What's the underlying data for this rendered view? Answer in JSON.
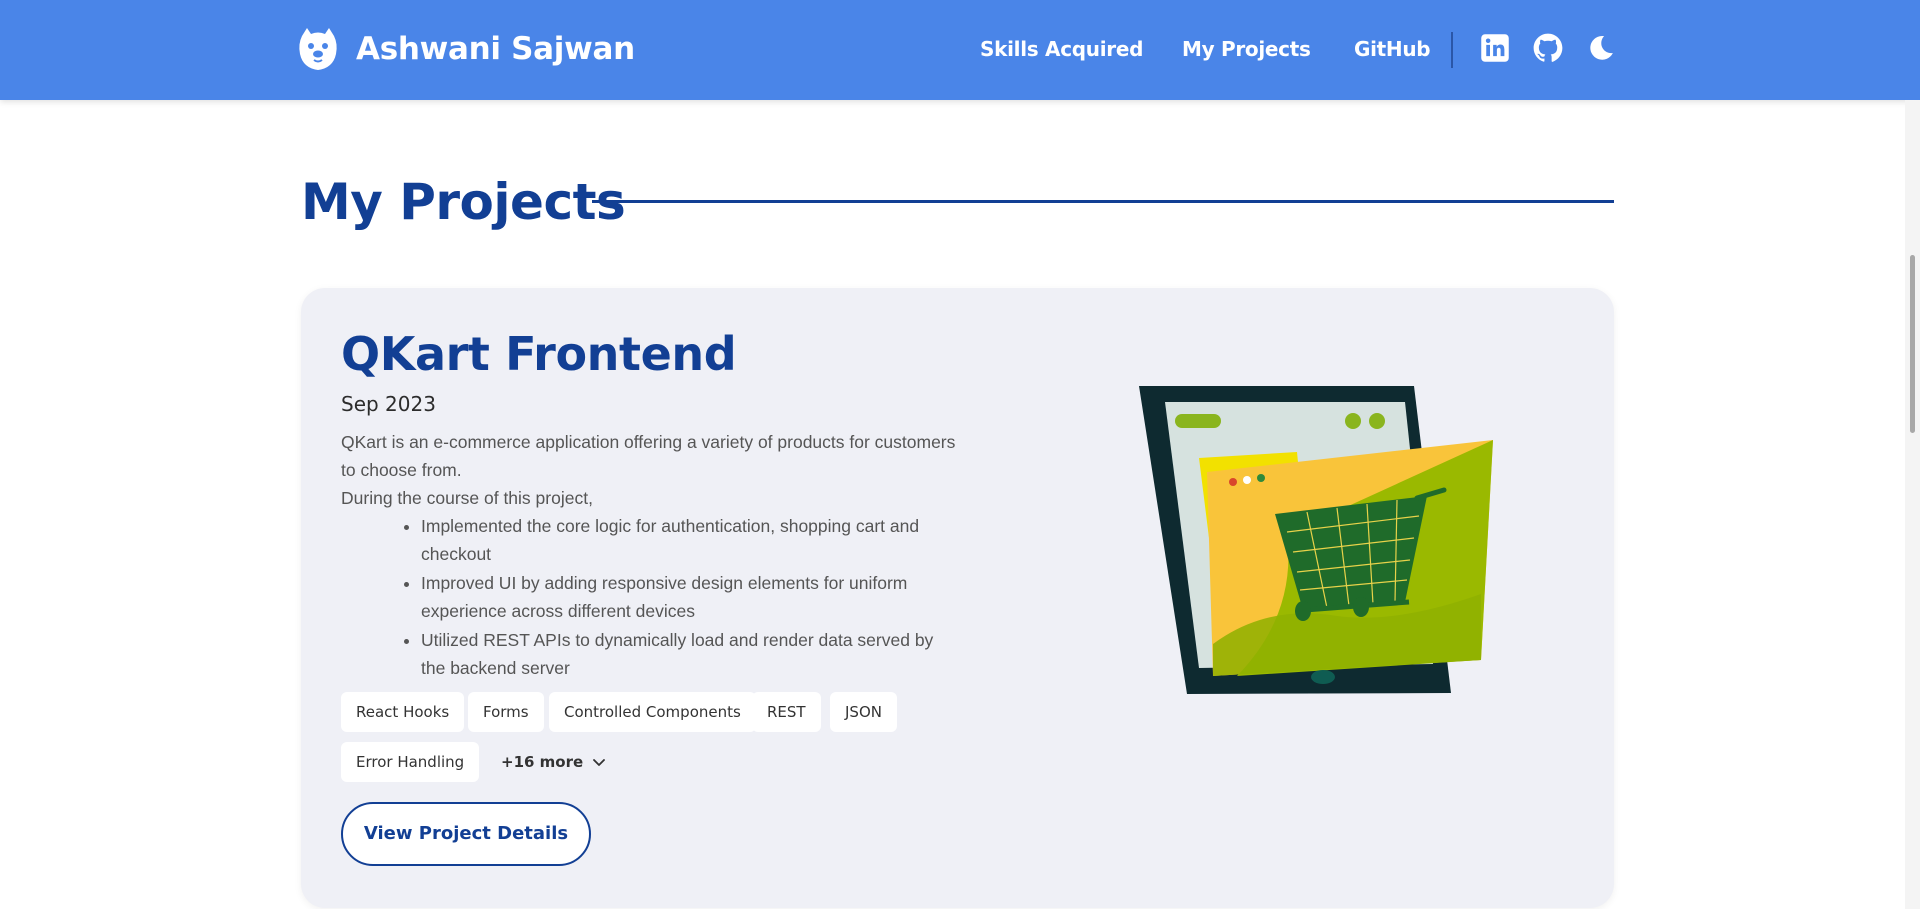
{
  "header": {
    "brand_name": "Ashwani Sajwan",
    "nav": {
      "skills": "Skills Acquired",
      "projects": "My Projects",
      "github": "GitHub"
    },
    "icons": [
      "linkedin-icon",
      "github-icon",
      "moon-icon"
    ],
    "bg_color": "#4a85e8"
  },
  "section": {
    "title": "My Projects",
    "accent_color": "#123f94"
  },
  "project": {
    "title": "QKart Frontend",
    "date": "Sep 2023",
    "description_lines": [
      "QKart is an e-commerce application offering a variety of products for customers to choose from.",
      "During the course of this project,"
    ],
    "bullets": [
      "Implemented the core logic for authentication, shopping cart and checkout",
      "Improved UI by adding responsive design elements for uniform experience across different devices",
      "Utilized REST APIs to dynamically load and render data served by the backend server"
    ],
    "tags": [
      "React Hooks",
      "Forms",
      "Controlled Components",
      "REST",
      "JSON",
      "Error Handling"
    ],
    "more_label": "+16 more",
    "view_button_label": "View Project Details",
    "card_bg": "#eff0f6"
  }
}
